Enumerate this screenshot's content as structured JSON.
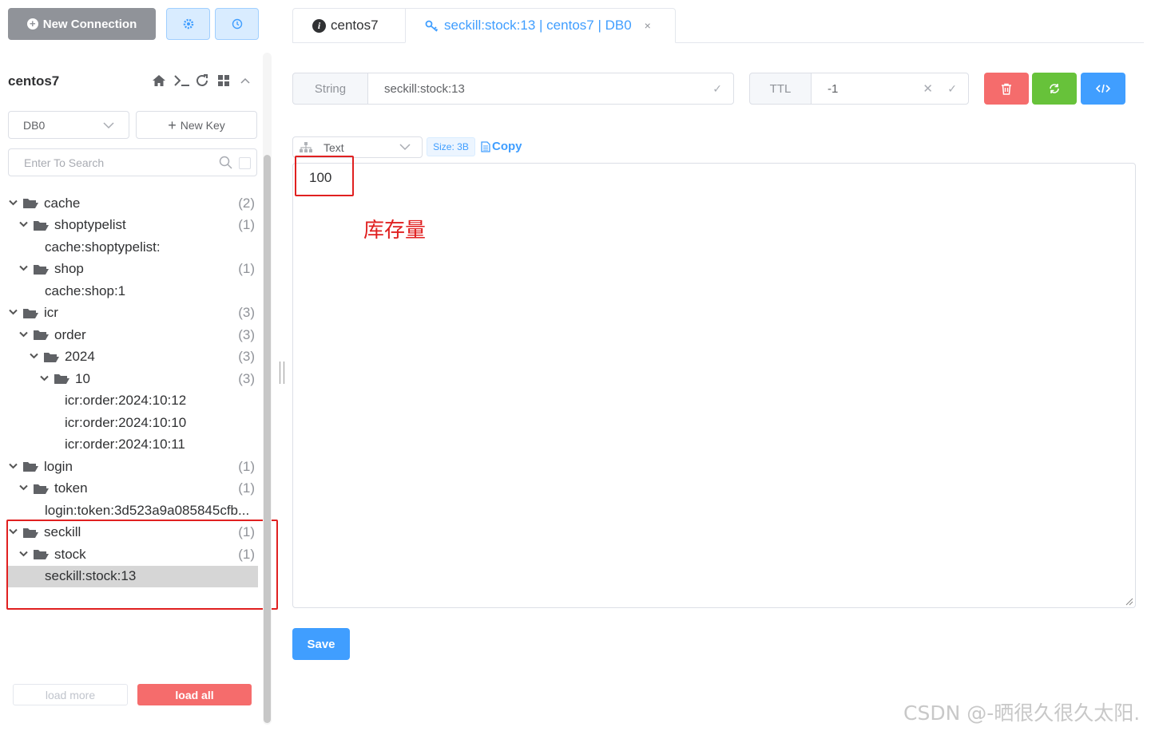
{
  "sidebar": {
    "new_connection_label": "New Connection",
    "connection_name": "centos7",
    "db_selected": "DB0",
    "new_key_label": "New Key",
    "search_placeholder": "Enter To Search",
    "load_more_label": "load more",
    "load_all_label": "load all",
    "tree": [
      {
        "label": "cache",
        "count": "(2)",
        "type": "folder",
        "depth": 0
      },
      {
        "label": "shoptypelist",
        "count": "(1)",
        "type": "folder",
        "depth": 1
      },
      {
        "label": "cache:shoptypelist:",
        "count": "",
        "type": "key",
        "depth": 2
      },
      {
        "label": "shop",
        "count": "(1)",
        "type": "folder",
        "depth": 1
      },
      {
        "label": "cache:shop:1",
        "count": "",
        "type": "key",
        "depth": 2
      },
      {
        "label": "icr",
        "count": "(3)",
        "type": "folder",
        "depth": 0
      },
      {
        "label": "order",
        "count": "(3)",
        "type": "folder",
        "depth": 1
      },
      {
        "label": "2024",
        "count": "(3)",
        "type": "folder",
        "depth": 2
      },
      {
        "label": "10",
        "count": "(3)",
        "type": "folder",
        "depth": 3
      },
      {
        "label": "icr:order:2024:10:12",
        "count": "",
        "type": "key",
        "depth": 4
      },
      {
        "label": "icr:order:2024:10:10",
        "count": "",
        "type": "key",
        "depth": 4
      },
      {
        "label": "icr:order:2024:10:11",
        "count": "",
        "type": "key",
        "depth": 4
      },
      {
        "label": "login",
        "count": "(1)",
        "type": "folder",
        "depth": 0
      },
      {
        "label": "token",
        "count": "(1)",
        "type": "folder",
        "depth": 1
      },
      {
        "label": "login:token:3d523a9a085845cfb...",
        "count": "",
        "type": "key",
        "depth": 2
      },
      {
        "label": "seckill",
        "count": "(1)",
        "type": "folder",
        "depth": 0
      },
      {
        "label": "stock",
        "count": "(1)",
        "type": "folder",
        "depth": 1
      },
      {
        "label": "seckill:stock:13",
        "count": "",
        "type": "key",
        "depth": 2,
        "selected": true
      }
    ]
  },
  "tabs": [
    {
      "label": "centos7"
    },
    {
      "label": "seckill:stock:13 | centos7 | DB0",
      "close": "×"
    }
  ],
  "key_panel": {
    "type_label": "String",
    "key_name": "seckill:stock:13",
    "ttl_label": "TTL",
    "ttl_value": "-1",
    "format_selected": "Text",
    "size_label": "Size: 3B",
    "copy_label": "Copy",
    "value": "100",
    "annotation": "库存量",
    "save_label": "Save"
  },
  "watermark": "CSDN @-晒很久很久太阳.",
  "colors": {
    "primary": "#409eff",
    "danger": "#f56c6c",
    "success": "#67c23a",
    "highlight": "#e02020"
  }
}
